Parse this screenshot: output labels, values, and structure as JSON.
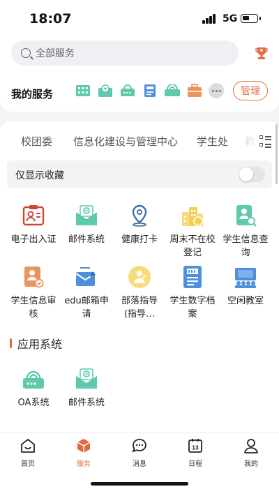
{
  "status_bar": {
    "time": "18:07",
    "network": "5G"
  },
  "search": {
    "placeholder": "全部服务"
  },
  "my_services": {
    "title": "我的服务",
    "manage_label": "管理"
  },
  "tabs": [
    {
      "label": "校团委"
    },
    {
      "label": "信息化建设与管理中心"
    },
    {
      "label": "学生处"
    },
    {
      "label": "教"
    }
  ],
  "favorites_only": {
    "label": "仅显示收藏",
    "enabled": false
  },
  "apps": [
    {
      "label": "电子出入证",
      "icon": "id-card-icon",
      "color": "#c9483b"
    },
    {
      "label": "邮件系统",
      "icon": "mail-icon",
      "color": "#5fc9ae"
    },
    {
      "label": "健康打卡",
      "icon": "location-pin-icon",
      "color": "#3f6fa8"
    },
    {
      "label": "周末不在校登记",
      "icon": "building-icon",
      "color": "#f2cf57"
    },
    {
      "label": "学生信息查询",
      "icon": "student-search-icon",
      "color": "#5fc9ae"
    },
    {
      "label": "学生信息审核",
      "icon": "student-review-icon",
      "color": "#e8955b"
    },
    {
      "label": "edu邮箱申请",
      "icon": "edu-mail-icon",
      "color": "#4f8fdb"
    },
    {
      "label": "部落指导(指导…",
      "icon": "tribe-guide-icon",
      "color": "#f2cf57"
    },
    {
      "label": "学生数字档案",
      "icon": "digital-archive-icon",
      "color": "#4f8fdb"
    },
    {
      "label": "空闲教室",
      "icon": "classroom-icon",
      "color": "#4f8fdb"
    }
  ],
  "app_systems": {
    "title": "应用系统",
    "items": [
      {
        "label": "OA系统",
        "icon": "oa-router-icon",
        "color": "#5fc9ae"
      },
      {
        "label": "邮件系统",
        "icon": "mail-icon",
        "color": "#5fc9ae"
      }
    ]
  },
  "bottom_nav": [
    {
      "label": "首页",
      "icon": "home-icon",
      "active": false
    },
    {
      "label": "服务",
      "icon": "cube-icon",
      "active": true
    },
    {
      "label": "消息",
      "icon": "chat-icon",
      "active": false
    },
    {
      "label": "日程",
      "icon": "calendar-icon",
      "active": false,
      "calendar_day": "13"
    },
    {
      "label": "我的",
      "icon": "user-icon",
      "active": false
    }
  ],
  "colors": {
    "accent": "#e26a3f",
    "teal": "#5fc9ae",
    "blue": "#4f8fdb",
    "yellow": "#f2cf57"
  }
}
